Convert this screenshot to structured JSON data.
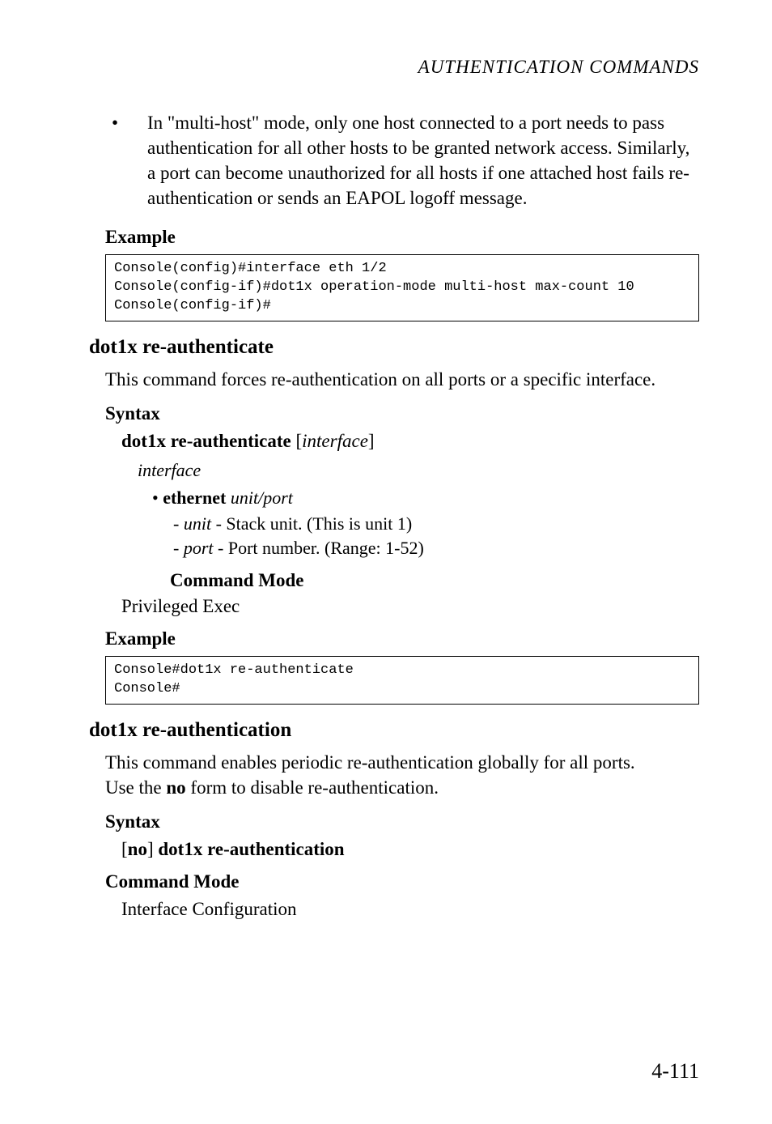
{
  "running_head": "AUTHENTICATION COMMANDS",
  "top_bullet": "In \"multi-host\" mode, only one host connected to a port needs to pass authentication for all other hosts to be granted network access. Similarly, a port can become unauthorized for all hosts if one attached host fails re-authentication or sends an EAPOL logoff message.",
  "labels": {
    "example": "Example",
    "syntax": "Syntax",
    "command_mode": "Command Mode"
  },
  "code1": "Console(config)#interface eth 1/2\nConsole(config-if)#dot1x operation-mode multi-host max-count 10\nConsole(config-if)#",
  "sec1": {
    "title": "dot1x re-authenticate",
    "desc": "This command forces re-authentication on all ports or a specific interface.",
    "syntax_bold": "dot1x re-authenticate",
    "syntax_ital": "interface",
    "interface_word": "interface",
    "eth_bullet_bold": "ethernet",
    "eth_bullet_ital": "unit/port",
    "dash1_ital": "unit",
    "dash1_rest": " - Stack unit. (This is unit 1)",
    "dash2_ital": "port",
    "dash2_rest": " - Port number. (Range: 1-52)",
    "priv": "Privileged Exec",
    "code": "Console#dot1x re-authenticate\nConsole#"
  },
  "sec2": {
    "title": "dot1x re-authentication",
    "desc_line1": "This command enables periodic re-authentication globally for all ports.",
    "desc_line2a": "Use the ",
    "desc_line2_bold": "no",
    "desc_line2b": " form to disable re-authentication.",
    "syntax_pre": "[",
    "syntax_no": "no",
    "syntax_mid": "] ",
    "syntax_bold": "dot1x re-authentication",
    "mode_text": "Interface Configuration"
  },
  "page_number": "4-111"
}
